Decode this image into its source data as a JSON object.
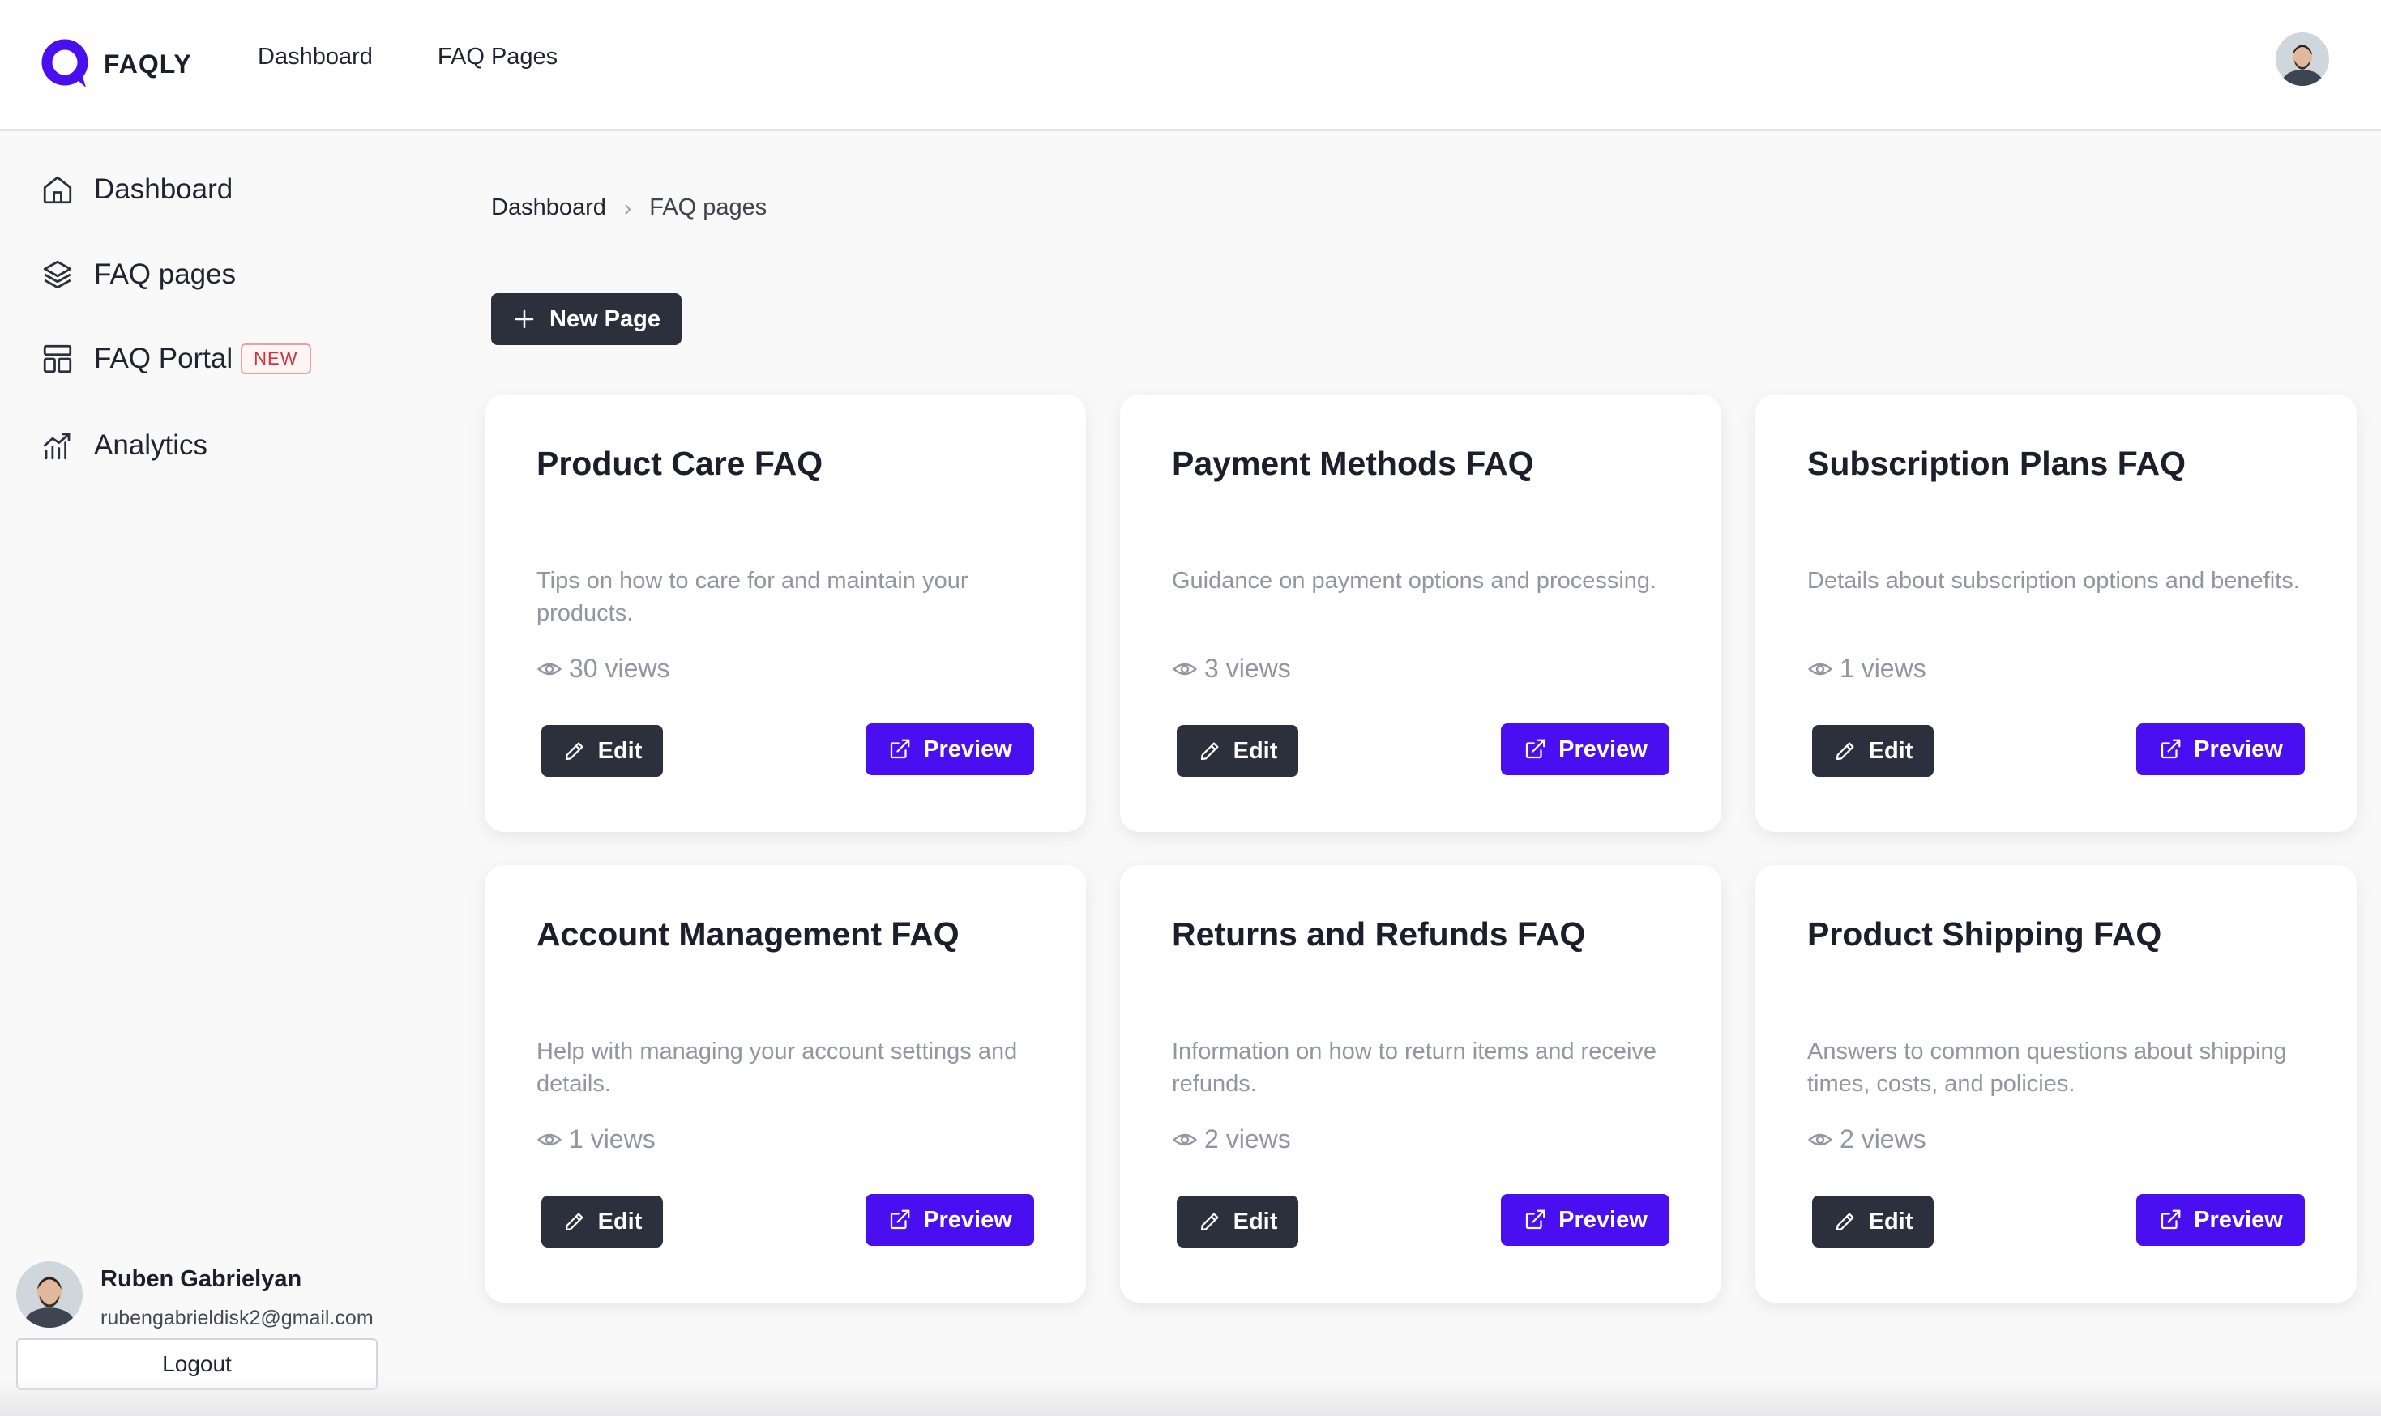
{
  "app": {
    "brand": "FAQLY"
  },
  "top_nav": {
    "items": [
      "Dashboard",
      "FAQ Pages"
    ]
  },
  "sidebar": {
    "items": [
      {
        "label": "Dashboard",
        "icon": "home-icon"
      },
      {
        "label": "FAQ pages",
        "icon": "layers-icon"
      },
      {
        "label": "FAQ Portal",
        "icon": "layout-icon",
        "badge": "NEW"
      },
      {
        "label": "Analytics",
        "icon": "chart-icon"
      }
    ]
  },
  "user": {
    "name": "Ruben Gabrielyan",
    "email": "rubengabrieldisk2@gmail.com",
    "logout_label": "Logout"
  },
  "breadcrumb": {
    "home": "Dashboard",
    "separator": "›",
    "current": "FAQ pages"
  },
  "toolbar": {
    "new_page_label": "New Page"
  },
  "cards": [
    {
      "title": "Product Care FAQ",
      "description": "Tips on how to care for and maintain your products.",
      "views": "30 views",
      "edit_label": "Edit",
      "preview_label": "Preview"
    },
    {
      "title": "Payment Methods FAQ",
      "description": "Guidance on payment options and processing.",
      "views": "3 views",
      "edit_label": "Edit",
      "preview_label": "Preview"
    },
    {
      "title": "Subscription Plans FAQ",
      "description": "Details about subscription options and benefits.",
      "views": "1 views",
      "edit_label": "Edit",
      "preview_label": "Preview"
    },
    {
      "title": "Account Management FAQ",
      "description": "Help with managing your account settings and details.",
      "views": "1 views",
      "edit_label": "Edit",
      "preview_label": "Preview"
    },
    {
      "title": "Returns and Refunds FAQ",
      "description": "Information on how to return items and receive refunds.",
      "views": "2 views",
      "edit_label": "Edit",
      "preview_label": "Preview"
    },
    {
      "title": "Product Shipping FAQ",
      "description": "Answers to common questions about shipping times, costs, and policies.",
      "views": "2 views",
      "edit_label": "Edit",
      "preview_label": "Preview"
    }
  ],
  "colors": {
    "accent": "#4a0ff0",
    "dark_button": "#2b303c",
    "badge_red": "#d1343e"
  }
}
